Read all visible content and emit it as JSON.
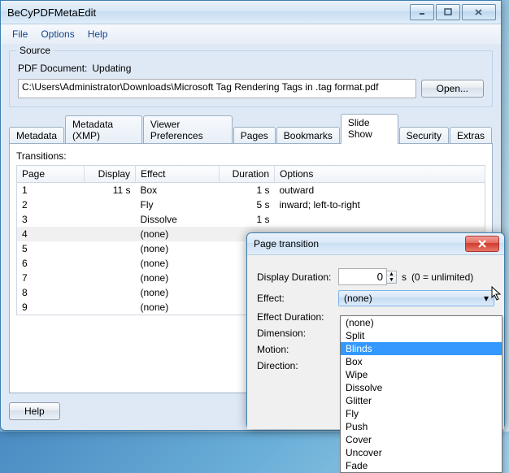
{
  "app": {
    "title": "BeCyPDFMetaEdit"
  },
  "menu": {
    "file": "File",
    "options": "Options",
    "help": "Help"
  },
  "source": {
    "group": "Source",
    "doc_label": "PDF Document:",
    "status": "Updating",
    "path": "C:\\Users\\Administrator\\Downloads\\Microsoft Tag Rendering Tags in .tag format.pdf",
    "open": "Open..."
  },
  "tabs": {
    "metadata": "Metadata",
    "metadata_xmp": "Metadata (XMP)",
    "viewer_prefs": "Viewer Preferences",
    "pages": "Pages",
    "bookmarks": "Bookmarks",
    "slide_show": "Slide Show",
    "security": "Security",
    "extras": "Extras"
  },
  "transitions": {
    "label": "Transitions:",
    "cols": {
      "page": "Page",
      "display": "Display",
      "effect": "Effect",
      "duration": "Duration",
      "options": "Options"
    },
    "rows": [
      {
        "page": "1",
        "display": "11 s",
        "effect": "Box",
        "duration": "1 s",
        "options": "outward"
      },
      {
        "page": "2",
        "display": "",
        "effect": "Fly",
        "duration": "5 s",
        "options": "inward; left-to-right"
      },
      {
        "page": "3",
        "display": "",
        "effect": "Dissolve",
        "duration": "1 s",
        "options": ""
      },
      {
        "page": "4",
        "display": "",
        "effect": "(none)",
        "duration": "",
        "options": ""
      },
      {
        "page": "5",
        "display": "",
        "effect": "(none)",
        "duration": "",
        "options": ""
      },
      {
        "page": "6",
        "display": "",
        "effect": "(none)",
        "duration": "",
        "options": ""
      },
      {
        "page": "7",
        "display": "",
        "effect": "(none)",
        "duration": "",
        "options": ""
      },
      {
        "page": "8",
        "display": "",
        "effect": "(none)",
        "duration": "",
        "options": ""
      },
      {
        "page": "9",
        "display": "",
        "effect": "(none)",
        "duration": "",
        "options": ""
      }
    ]
  },
  "help_btn": "Help",
  "dialog": {
    "title": "Page transition",
    "display_duration": "Display Duration:",
    "duration_value": "0",
    "unit_s": "s",
    "unlimited": "(0 = unlimited)",
    "effect": "Effect:",
    "effect_value": "(none)",
    "effect_duration": "Effect Duration:",
    "dimension": "Dimension:",
    "motion": "Motion:",
    "direction": "Direction:",
    "options": [
      "(none)",
      "Split",
      "Blinds",
      "Box",
      "Wipe",
      "Dissolve",
      "Glitter",
      "Fly",
      "Push",
      "Cover",
      "Uncover",
      "Fade"
    ],
    "hilite_index": 2
  }
}
